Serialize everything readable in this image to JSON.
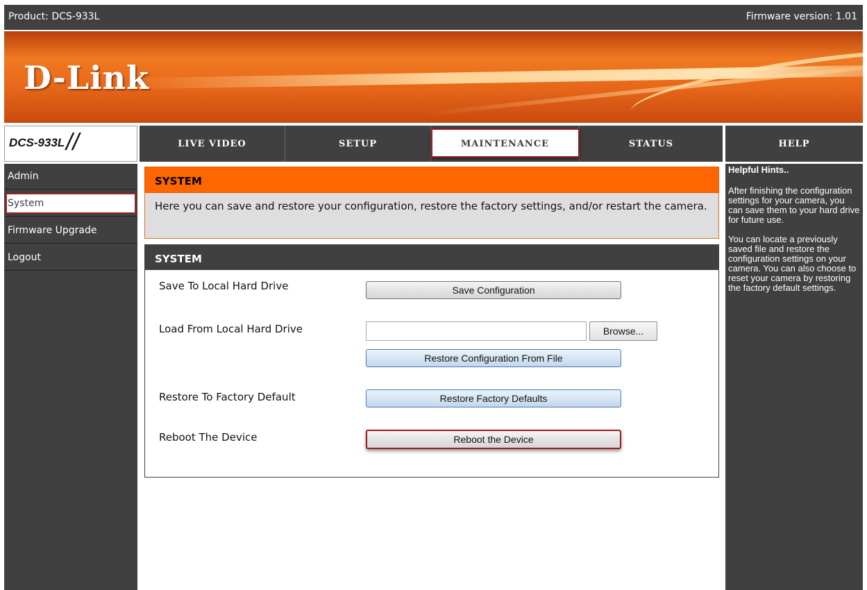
{
  "topbar": {
    "product": "Product: DCS-933L",
    "firmware": "Firmware version: 1.01"
  },
  "banner": {
    "logo": "D-Link"
  },
  "nav": {
    "model": "DCS-933L",
    "model_slashes": "//",
    "tabs": [
      "LIVE VIDEO",
      "SETUP",
      "MAINTENANCE",
      "STATUS"
    ],
    "active_tab": "MAINTENANCE",
    "help": "HELP"
  },
  "sidebar": {
    "items": [
      "Admin",
      "System",
      "Firmware Upgrade",
      "Logout"
    ],
    "selected": "System"
  },
  "main": {
    "header_title": "SYSTEM",
    "description": "Here you can save and restore your configuration, restore the factory settings, and/or restart the camera.",
    "panel_title": "SYSTEM",
    "rows": {
      "save_label": "Save To Local Hard Drive",
      "save_button": "Save Configuration",
      "load_label": "Load From Local Hard Drive",
      "file_value": "",
      "browse_button": "Browse...",
      "restore_file_button": "Restore Configuration From File",
      "factory_label": "Restore To Factory Default",
      "factory_button": "Restore Factory Defaults",
      "reboot_label": "Reboot The Device",
      "reboot_button": "Reboot the Device"
    }
  },
  "hints": {
    "title": "Helpful Hints..",
    "p1": "After finishing the configuration settings for your camera, you can save them to your hard drive for future use.",
    "p2": "You can locate a previously saved file and restore the configuration settings on your camera. You can also choose to reset your camera by restoring the factory default settings."
  },
  "colors": {
    "dark": "#404040",
    "orange": "#ff6600",
    "highlight": "#9c1c1c"
  }
}
